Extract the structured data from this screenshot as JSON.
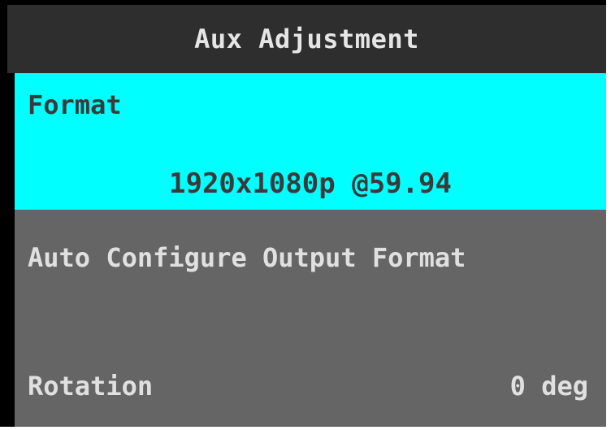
{
  "header": {
    "title": "Aux Adjustment"
  },
  "menu": {
    "items": [
      {
        "label": "Format",
        "value": "1920x1080p @59.94",
        "selected": true
      },
      {
        "label": "Auto Configure Output Format",
        "selected": false
      },
      {
        "label": "Rotation",
        "value": "0 deg",
        "selected": false
      }
    ]
  },
  "colors": {
    "background_frame": "#000000",
    "header_bg": "#2e2e2e",
    "selected_bg": "#00ffff",
    "selected_text": "#3a3a3a",
    "item_bg": "#656565",
    "item_text": "#e0e0e0"
  }
}
